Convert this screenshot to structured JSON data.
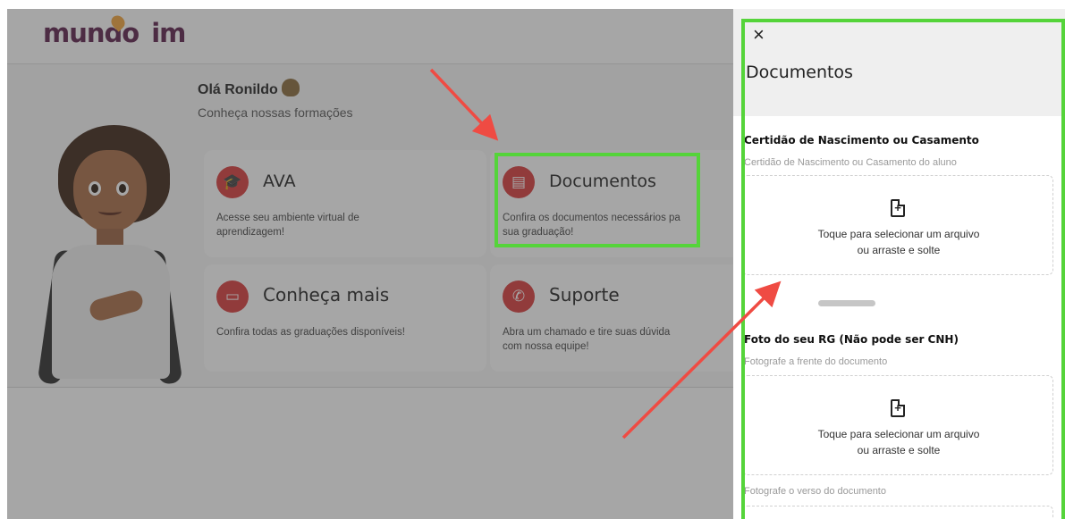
{
  "caption": "...ção ... ... ... ... ... g ...",
  "app": {
    "logo": "mundo",
    "logo_suffix": "im",
    "greeting": "Olá Ronildo",
    "subgreeting": "Conheça nossas formações"
  },
  "cards": [
    {
      "title": "AVA",
      "icon": "graduation-cap-icon",
      "desc_line1": "Acesse seu ambiente virtual de",
      "desc_line2": "aprendizagem!"
    },
    {
      "title": "Documentos",
      "icon": "document-icon",
      "desc_line1": "Confira os documentos necessários pa",
      "desc_line2": "sua graduação!"
    },
    {
      "title": "Conheça mais",
      "icon": "card-icon",
      "desc_line1": "Confira todas as graduações disponíveis!",
      "desc_line2": ""
    },
    {
      "title": "Suporte",
      "icon": "whatsapp-icon",
      "desc_line1": "Abra um chamado e tire suas dúvida",
      "desc_line2": "com nossa equipe!"
    }
  ],
  "drawer": {
    "close_symbol": "×",
    "title": "Documentos",
    "sections": [
      {
        "label": "Certidão de Nascimento ou Casamento",
        "hint": "Certidão de Nascimento ou Casamento do aluno",
        "upload_line1": "Toque para selecionar um arquivo",
        "upload_line2": "ou arraste e solte"
      },
      {
        "label": "Foto do seu RG (Não pode ser CNH)",
        "hint": "Fotografe a frente do documento",
        "upload_line1": "Toque para selecionar um arquivo",
        "upload_line2": "ou arraste e solte"
      }
    ],
    "next_hint": "Fotografe o verso do documento"
  },
  "colors": {
    "accent": "#d93a3a",
    "highlight": "#55d43a",
    "arrow": "#ef4b43",
    "logo": "#5b1f4a"
  }
}
